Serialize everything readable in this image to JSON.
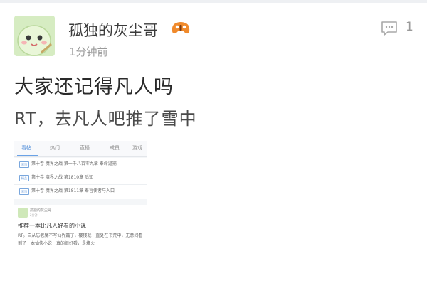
{
  "post": {
    "username": "孤独的灰尘哥",
    "time": "1分钟前",
    "comment_count": "1",
    "title": "大家还记得凡人吗",
    "body": "RT，去凡人吧推了雪中",
    "icons": {
      "avatar": "cartoon-avatar",
      "level_badge": "game-controller-icon",
      "comment": "comment-bubble-icon"
    },
    "colors": {
      "badge": "#f08a2c",
      "accent": "#4a8ad8"
    }
  },
  "thumbnail": {
    "tabs": [
      "看帖",
      "热门",
      "直播",
      "成员",
      "游戏"
    ],
    "active_tab": 0,
    "threads": [
      {
        "tag": "置顶",
        "text": "第十卷 魔界之战 第一千八百零九章 奉命追捕"
      },
      {
        "tag": "精品",
        "text": "第十卷 魔界之战 第1810章 后知"
      },
      {
        "tag": "置顶",
        "text": "第十卷 魔界之战 第1811章 奉旨使者与入口"
      }
    ],
    "card": {
      "user": "孤独的灰尘哥",
      "time": "2分钟",
      "title": "推荐一本比凡人好看的小说",
      "body": "RT。自从忘老魔不写仙界篇了，楼楼就一直处在书荒中，无意间看到了一本仙侠小说，真的很好看，是烽火"
    }
  }
}
